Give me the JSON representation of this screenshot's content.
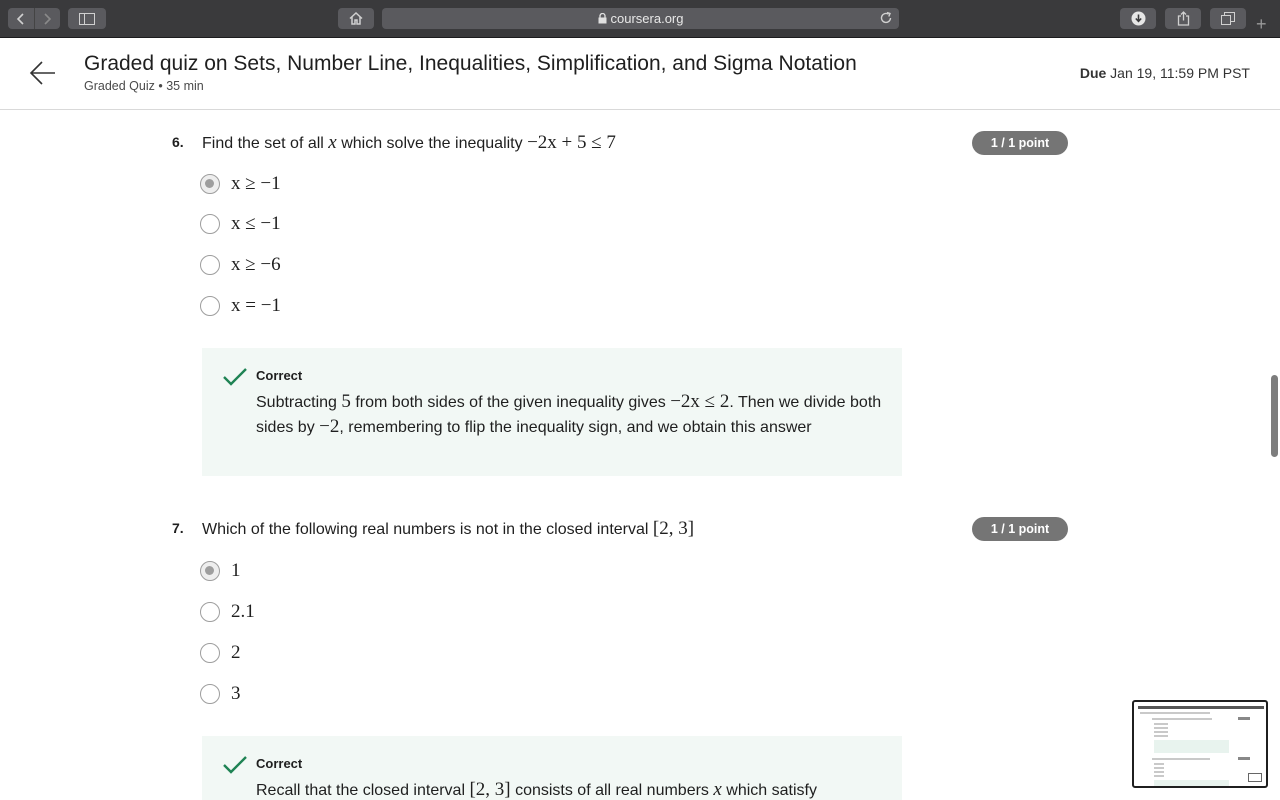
{
  "browser": {
    "url": "coursera.org",
    "new_tab_symbol": "+"
  },
  "header": {
    "title": "Graded quiz on Sets, Number Line, Inequalities, Simplification, and Sigma Notation",
    "subtitle": "Graded Quiz • 35 min",
    "due_label": "Due",
    "due_value": "Jan 19, 11:59 PM PST"
  },
  "questions": [
    {
      "number": "6.",
      "text": "Find the set of all",
      "var": "x",
      "text2": "which solve the inequality",
      "expr": "−2x + 5 ≤ 7",
      "points": "1 / 1 point",
      "options": [
        "x ≥ −1",
        "x ≤ −1",
        "x ≥ −6",
        "x = −1"
      ],
      "selected_index": 0,
      "feedback": {
        "title": "Correct",
        "p1": "Subtracting",
        "m1": "5",
        "p2": "from both sides of the given inequality gives",
        "m2": "−2x ≤ 2",
        "p3": ". Then we divide both sides by",
        "m3": "−2",
        "p4": ", remembering to flip the inequality sign, and we obtain this answer"
      }
    },
    {
      "number": "7.",
      "text": "Which of the following real numbers is not in the closed interval",
      "expr": "[2, 3]",
      "points": "1 / 1 point",
      "options": [
        "1",
        "2.1",
        "2",
        "3"
      ],
      "selected_index": 0,
      "feedback": {
        "title": "Correct",
        "p1": "Recall that the closed interval",
        "m1": "[2, 3]",
        "p2": "consists of all real numbers",
        "m2": "x",
        "p3": "which satisfy"
      }
    }
  ],
  "colors": {
    "accent_green": "#1f8354",
    "feedback_bg": "#f2f8f5",
    "points_badge": "#757575"
  }
}
